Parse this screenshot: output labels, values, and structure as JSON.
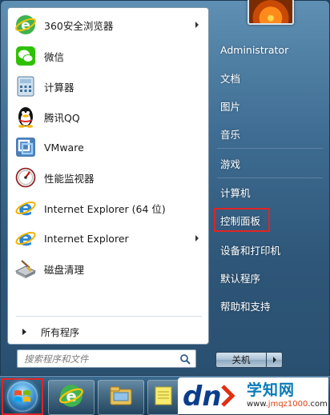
{
  "programs": [
    {
      "label": "360安全浏览器",
      "icon": "360-browser-icon",
      "has_submenu": true
    },
    {
      "label": "微信",
      "icon": "wechat-icon",
      "has_submenu": false
    },
    {
      "label": "计算器",
      "icon": "calculator-icon",
      "has_submenu": false
    },
    {
      "label": "腾讯QQ",
      "icon": "qq-penguin-icon",
      "has_submenu": false
    },
    {
      "label": "VMware",
      "icon": "vmware-icon",
      "has_submenu": false
    },
    {
      "label": "性能监视器",
      "icon": "performance-monitor-icon",
      "has_submenu": false
    },
    {
      "label": "Internet Explorer (64 位)",
      "icon": "internet-explorer-icon",
      "has_submenu": false
    },
    {
      "label": "Internet Explorer",
      "icon": "internet-explorer-icon",
      "has_submenu": true
    },
    {
      "label": "磁盘清理",
      "icon": "disk-cleanup-icon",
      "has_submenu": false
    }
  ],
  "all_programs_label": "所有程序",
  "search": {
    "placeholder": "搜索程序和文件"
  },
  "right_links": [
    {
      "label": "Administrator"
    },
    {
      "label": "文档"
    },
    {
      "label": "图片"
    },
    {
      "label": "音乐"
    },
    {
      "label": "游戏"
    },
    {
      "label": "计算机"
    },
    {
      "label": "控制面板",
      "highlighted": true
    },
    {
      "label": "设备和打印机"
    },
    {
      "label": "默认程序"
    },
    {
      "label": "帮助和支持"
    }
  ],
  "shutdown_label": "关机",
  "watermark": {
    "title": "学知网",
    "url_prefix": "www.",
    "url_main": "jmqz1000",
    "url_suffix": ".com"
  },
  "colors": {
    "highlight_box": "#e02424",
    "accent": "#0a7ab8"
  }
}
